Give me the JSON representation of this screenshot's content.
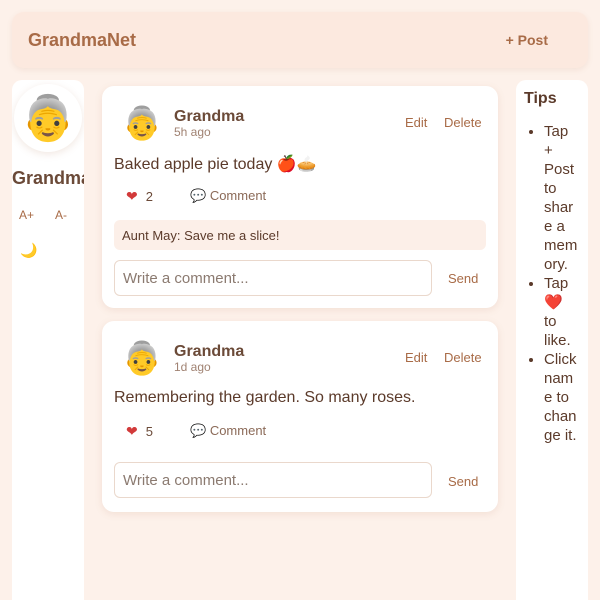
{
  "header": {
    "brand": "GrandmaNet",
    "post_button": "+ Post"
  },
  "sidebar": {
    "avatar_icon": "grandma-emoji",
    "name": "Grandma",
    "font_increase": "A+",
    "font_decrease": "A-",
    "theme_icon": "moon-icon"
  },
  "posts": [
    {
      "author": "Grandma",
      "time": "5h ago",
      "edit": "Edit",
      "delete": "Delete",
      "text": "Baked apple pie today 🍎🥧",
      "likes": "2",
      "comment_label": "Comment",
      "comments": [
        {
          "text": "Aunt May: Save me a slice!"
        }
      ],
      "comment_placeholder": "Write a comment...",
      "send": "Send"
    },
    {
      "author": "Grandma",
      "time": "1d ago",
      "edit": "Edit",
      "delete": "Delete",
      "text": "Remembering the garden. So many roses.",
      "likes": "5",
      "comment_label": "Comment",
      "comments": [],
      "comment_placeholder": "Write a comment...",
      "send": "Send"
    }
  ],
  "tips": {
    "title": "Tips",
    "items": [
      "Tap + Post to share a memory.",
      "Tap ❤️ to like.",
      "Click name to change it."
    ]
  },
  "colors": {
    "accent": "#a86b47",
    "background": "#fdf1ea",
    "heart": "#d23a3a"
  }
}
